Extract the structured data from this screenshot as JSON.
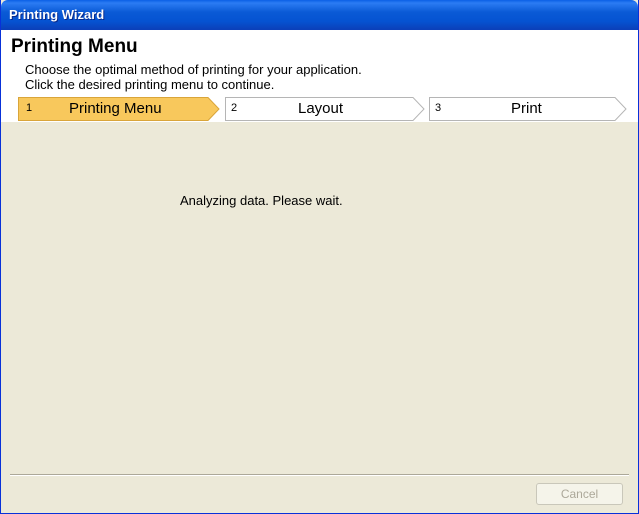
{
  "window": {
    "title": "Printing Wizard"
  },
  "header": {
    "heading": "Printing Menu",
    "description_line1": "Choose the optimal method of printing for your application.",
    "description_line2": "Click the desired printing menu to continue."
  },
  "steps": [
    {
      "number": "1",
      "label": "Printing Menu",
      "active": true
    },
    {
      "number": "2",
      "label": "Layout",
      "active": false
    },
    {
      "number": "3",
      "label": "Print",
      "active": false
    }
  ],
  "content": {
    "status_message": "Analyzing data. Please wait."
  },
  "footer": {
    "cancel_label": "Cancel",
    "cancel_enabled": false
  },
  "colors": {
    "titlebar": "#0a5ad6",
    "active_step": "#f8c85c",
    "panel": "#ece9d8"
  }
}
